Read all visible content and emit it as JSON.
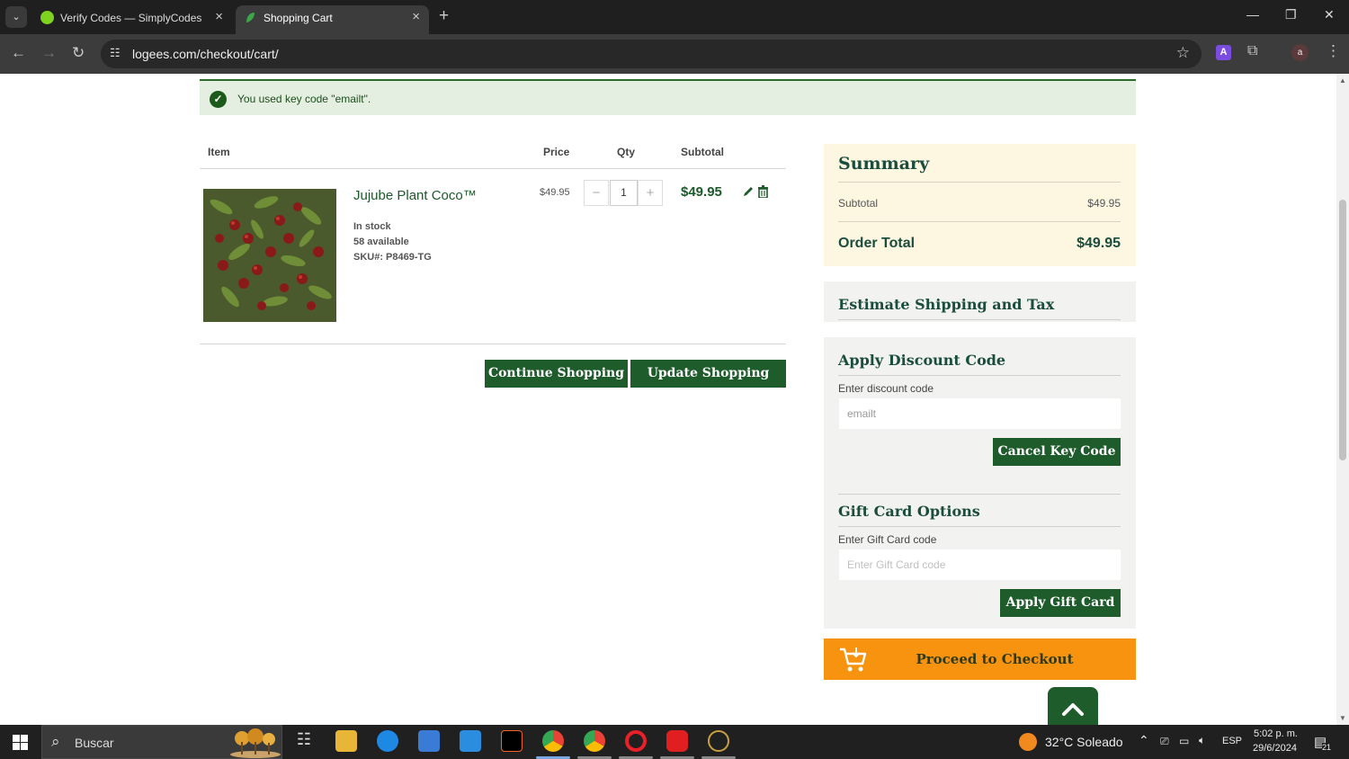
{
  "browser": {
    "tabs": [
      {
        "title": "Verify Codes — SimplyCodes",
        "active": false
      },
      {
        "title": "Shopping Cart",
        "active": true
      }
    ],
    "url": "logees.com/checkout/cart/",
    "profile_initial": "a",
    "extension_label": "A"
  },
  "notice": {
    "text": "You used key code \"emailt\"."
  },
  "cart": {
    "headers": {
      "item": "Item",
      "price": "Price",
      "qty": "Qty",
      "subtotal": "Subtotal"
    },
    "item": {
      "name": "Jujube Plant Coco™",
      "stock": "In stock",
      "available": "58 available",
      "sku": "SKU#: P8469-TG",
      "price": "$49.95",
      "qty": "1",
      "subtotal": "$49.95"
    },
    "continue_label": "Continue Shopping",
    "update_label": "Update Shopping Cart"
  },
  "summary": {
    "title": "Summary",
    "subtotal_label": "Subtotal",
    "subtotal_value": "$49.95",
    "total_label": "Order Total",
    "total_value": "$49.95"
  },
  "shipping": {
    "title": "Estimate Shipping and Tax"
  },
  "discount": {
    "title": "Apply Discount Code",
    "label": "Enter discount code",
    "value": "emailt",
    "button": "Cancel Key Code"
  },
  "giftcard": {
    "title": "Gift Card Options",
    "label": "Enter Gift Card code",
    "placeholder": "Enter Gift Card code",
    "button": "Apply Gift Card"
  },
  "checkout": {
    "label": "Proceed to Checkout"
  },
  "taskbar": {
    "search_label": "Buscar",
    "weather": "32°C  Soleado",
    "language": "ESP",
    "time": "5:02 p. m.",
    "date": "29/6/2024",
    "notification_count": "21"
  },
  "colors": {
    "brand_green": "#1f5c2c",
    "checkout_orange": "#f7930e",
    "summary_bg": "#fdf6e1",
    "notice_bg": "#e5efe1"
  }
}
